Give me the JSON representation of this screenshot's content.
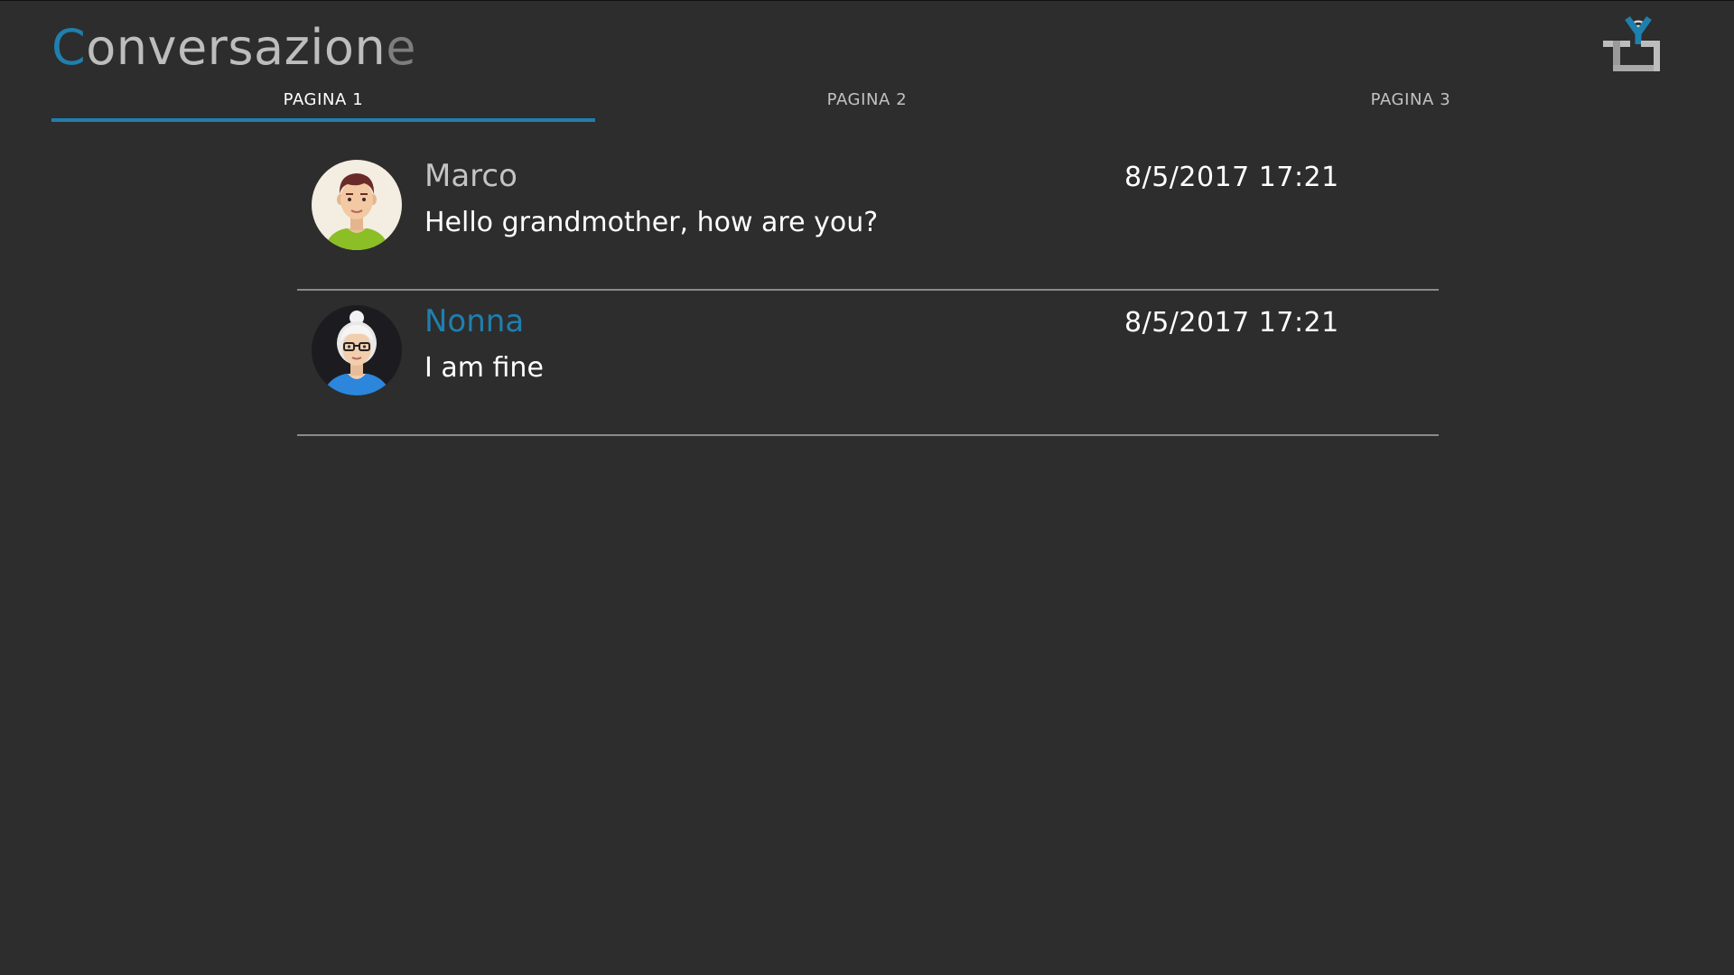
{
  "app": {
    "title_first": "C",
    "title_mid": "onversazion",
    "title_last": "e"
  },
  "logo": {
    "icon": "tv-wifi-logo-icon"
  },
  "tabs": [
    {
      "label": "PAGINA 1",
      "active": true
    },
    {
      "label": "PAGINA 2",
      "active": false
    },
    {
      "label": "PAGINA 3",
      "active": false
    }
  ],
  "messages": [
    {
      "sender": "Marco",
      "text": "Hello grandmother, how are you?",
      "timestamp": "8/5/2017 17:21",
      "avatar": "young-man-avatar-icon"
    },
    {
      "sender": "Nonna",
      "text": "I am fine",
      "timestamp": "8/5/2017 17:21",
      "avatar": "grandmother-avatar-icon"
    }
  ],
  "colors": {
    "background": "#2d2d2d",
    "accent": "#1f7fae",
    "divider": "#8a8a8a"
  }
}
